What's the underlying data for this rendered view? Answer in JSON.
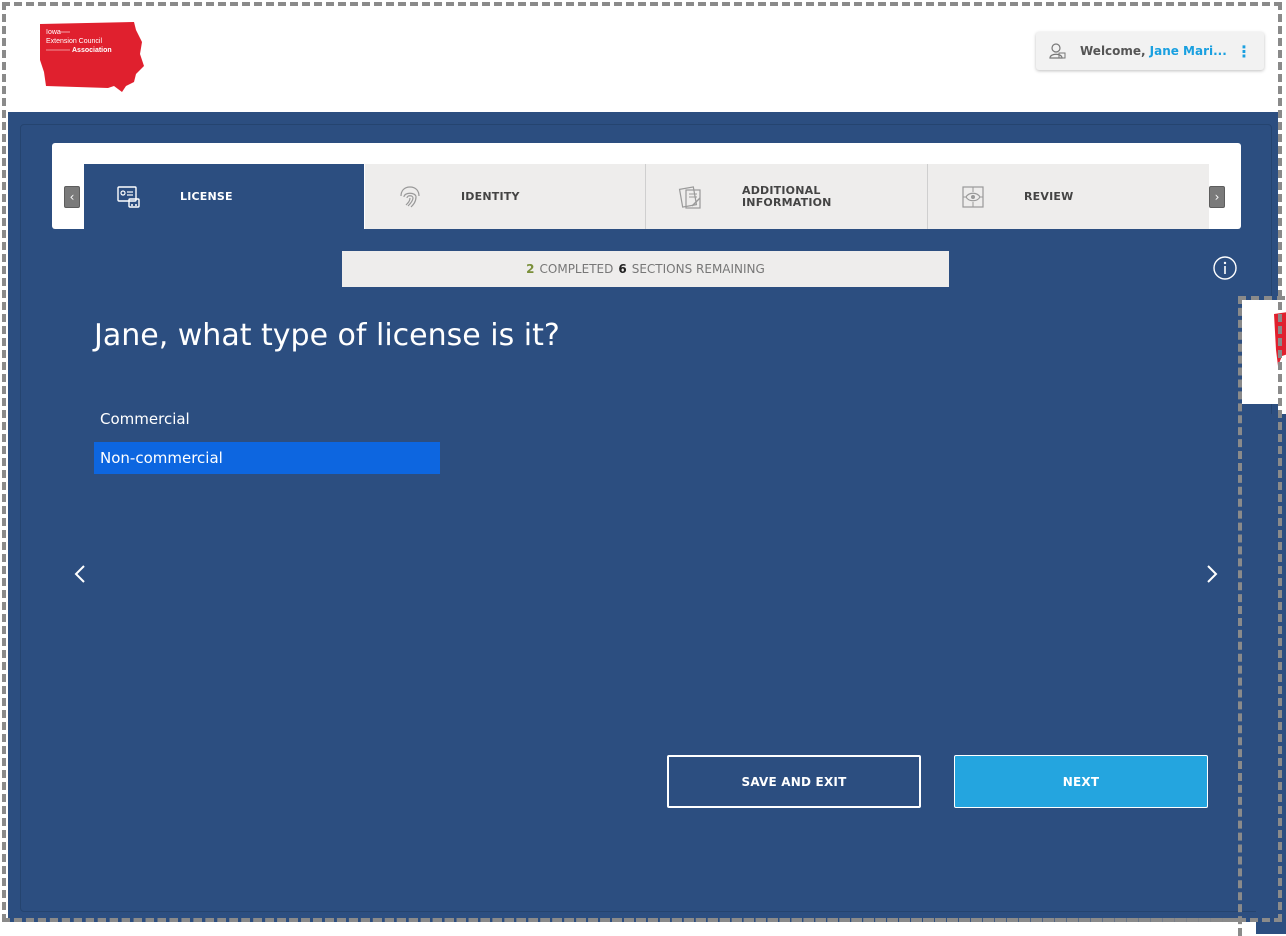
{
  "header": {
    "logo_line1": "Iowa",
    "logo_line2": "Extension Council",
    "logo_line3": "Association",
    "welcome_prefix": "Welcome,",
    "user_name": "Jane Mari...",
    "menu_icon": "kebab-icon"
  },
  "stepper": {
    "tabs": [
      {
        "label": "LICENSE",
        "icon": "license-card-icon",
        "active": true
      },
      {
        "label": "IDENTITY",
        "icon": "fingerprint-icon",
        "active": false
      },
      {
        "label_line1": "ADDITIONAL",
        "label_line2": "INFORMATION",
        "icon": "document-edit-icon",
        "active": false
      },
      {
        "label": "REVIEW",
        "icon": "eye-icon",
        "active": false
      }
    ]
  },
  "progress": {
    "completed_count": "2",
    "completed_label": "COMPLETED",
    "remaining_count": "6",
    "remaining_label": "SECTIONS REMAINING"
  },
  "question": "Jane, what type of license is it?",
  "options": [
    {
      "label": "Commercial",
      "selected": false
    },
    {
      "label": "Non-commercial",
      "selected": true
    }
  ],
  "actions": {
    "save_label": "SAVE AND EXIT",
    "next_label": "NEXT"
  },
  "colors": {
    "main_bg": "#2c4e80",
    "selected_option": "#0d66e0",
    "next_button": "#24a5df",
    "accent_text": "#1aa0e0",
    "logo_red": "#e0202e"
  }
}
